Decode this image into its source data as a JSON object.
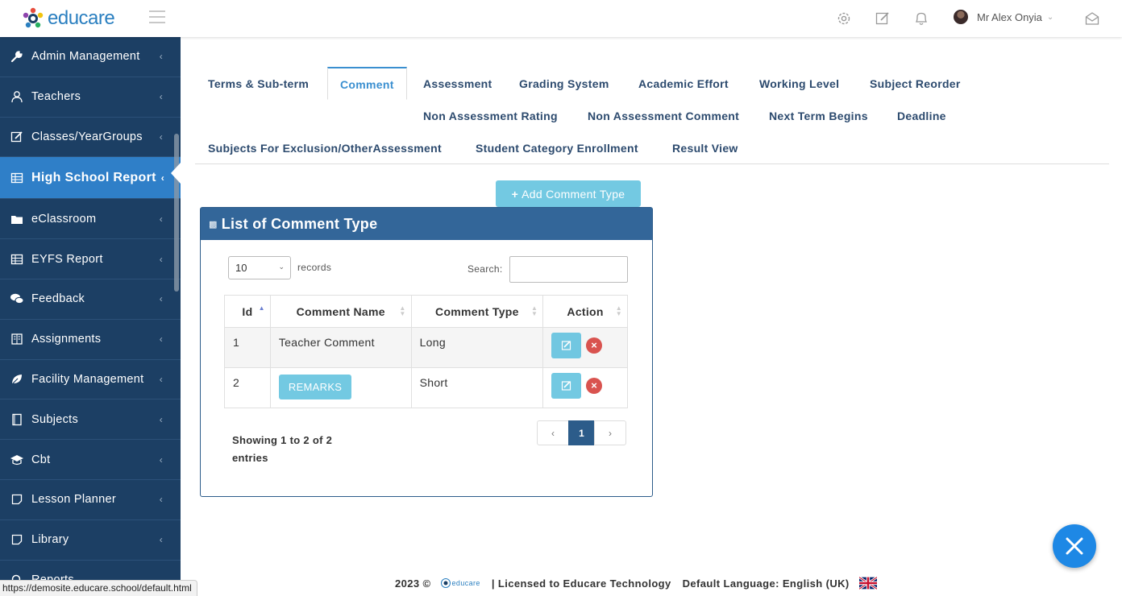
{
  "brand": {
    "logo_text": "educare"
  },
  "header": {
    "user_name": "Mr Alex Onyia"
  },
  "sidebar": {
    "items": [
      {
        "label": "Admin Management",
        "icon": "wrench-icon"
      },
      {
        "label": "Teachers",
        "icon": "teacher-icon"
      },
      {
        "label": "Classes/YearGroups",
        "icon": "edit-icon"
      },
      {
        "label": "High School Report",
        "icon": "table-icon"
      },
      {
        "label": "eClassroom",
        "icon": "folder-icon"
      },
      {
        "label": "EYFS Report",
        "icon": "table-icon"
      },
      {
        "label": "Feedback",
        "icon": "comments-icon"
      },
      {
        "label": "Assignments",
        "icon": "book-icon"
      },
      {
        "label": "Facility Management",
        "icon": "leaf-icon"
      },
      {
        "label": "Subjects",
        "icon": "book-outline-icon"
      },
      {
        "label": "Cbt",
        "icon": "graduation-cap-icon"
      },
      {
        "label": "Lesson Planner",
        "icon": "note-icon"
      },
      {
        "label": "Library",
        "icon": "note-icon"
      },
      {
        "label": "Reports",
        "icon": "search-icon"
      }
    ],
    "active_index": 3
  },
  "tabs": {
    "terms": "Terms & Sub-term",
    "comment": "Comment",
    "assessment": "Assessment",
    "grading": "Grading System",
    "academic_effort": "Academic Effort",
    "working_level": "Working Level",
    "subject_reorder": "Subject Reorder",
    "non_assessment_rating": "Non Assessment Rating",
    "non_assessment_comment": "Non Assessment Comment",
    "next_term": "Next Term Begins",
    "deadline": "Deadline",
    "subjects_exclusion": "Subjects For Exclusion/OtherAssessment",
    "student_category": "Student Category Enrollment",
    "result_view": "Result View"
  },
  "actions": {
    "add_comment_type": "Add Comment Type"
  },
  "panel": {
    "title": "List of Comment Type",
    "page_length": "10",
    "records_label": "records",
    "search_label": "Search:",
    "columns": [
      "Id",
      "Comment Name",
      "Comment Type",
      "Action"
    ],
    "rows": [
      {
        "id": "1",
        "name": "Teacher Comment",
        "type": "Long"
      },
      {
        "id": "2",
        "name": "REMARKS",
        "type": "Short"
      }
    ],
    "info": "Showing 1 to 2 of 2 entries",
    "pager": {
      "prev": "‹",
      "current": "1",
      "next": "›"
    }
  },
  "footer": {
    "year": "2023 ©",
    "mini_logo_text": "educare",
    "license": "|  Licensed to Educare Technology",
    "language": "Default Language: English (UK)"
  },
  "status_url": "https://demosite.educare.school/default.html",
  "colors": {
    "sidebar_bg": "#1c3f64",
    "active_item": "#2f7fc8",
    "panel_header": "#336699",
    "accent": "#5bc0de",
    "danger": "#d9534f",
    "fab": "#1e88e5"
  }
}
